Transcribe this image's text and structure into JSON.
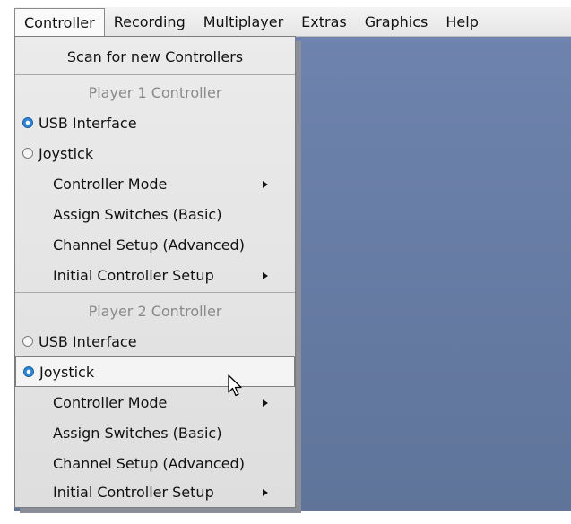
{
  "menubar": {
    "items": [
      "Controller",
      "Recording",
      "Multiplayer",
      "Extras",
      "Graphics",
      "Help"
    ]
  },
  "menu": {
    "scan": "Scan for new Controllers",
    "player1": {
      "header": "Player 1 Controller",
      "usb": "USB Interface",
      "joystick": "Joystick",
      "selected": "USB Interface",
      "mode": "Controller Mode",
      "assign": "Assign Switches (Basic)",
      "channel": "Channel Setup (Advanced)",
      "initial": "Initial Controller Setup"
    },
    "player2": {
      "header": "Player 2 Controller",
      "usb": "USB Interface",
      "joystick": "Joystick",
      "selected": "Joystick",
      "mode": "Controller Mode",
      "assign": "Assign Switches (Basic)",
      "channel": "Channel Setup (Advanced)",
      "initial": "Initial Controller Setup"
    }
  },
  "colors": {
    "radio_selected": "#2f86d6",
    "desktop": "#6e83ad",
    "header_text": "#8a8a8a"
  }
}
